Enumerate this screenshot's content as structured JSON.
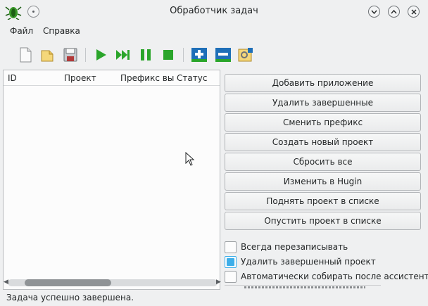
{
  "window": {
    "title": "Обработчик задач",
    "app_icon": "insect-app-icon",
    "controls": [
      "minimize-icon",
      "maximize-icon",
      "close-icon"
    ]
  },
  "menu": {
    "file": "Файл",
    "help": "Справка"
  },
  "toolbar": {
    "buttons": [
      "new-file-icon",
      "open-folder-icon",
      "save-icon",
      "play-icon",
      "fast-forward-icon",
      "pause-icon",
      "stop-icon",
      "add-icon",
      "remove-icon",
      "settings-icon"
    ]
  },
  "list": {
    "columns": {
      "id": "ID",
      "project": "Проект",
      "prefix": "Префикс вы",
      "status": "Статус"
    },
    "rows": []
  },
  "actions": {
    "add_app": "Добавить приложение",
    "remove_done": "Удалить завершенные",
    "change_prefix": "Сменить префикс",
    "new_project": "Создать новый проект",
    "reset_all": "Сбросить все",
    "edit_hugin": "Изменить в Hugin",
    "move_up": "Поднять проект в списке",
    "move_down": "Опустить проект в списке"
  },
  "options": {
    "always_overwrite": {
      "label": "Всегда перезаписывать",
      "checked": false
    },
    "delete_finished": {
      "label": "Удалить завершенный проект",
      "checked": true
    },
    "auto_assistant": {
      "label": "Автоматически собирать после ассистента",
      "checked": false
    }
  },
  "status": {
    "message": "Задача успешно завершена."
  },
  "colors": {
    "accent": "#3daee9",
    "play_green": "#2aa52a",
    "add_blue": "#1e6fb8"
  }
}
